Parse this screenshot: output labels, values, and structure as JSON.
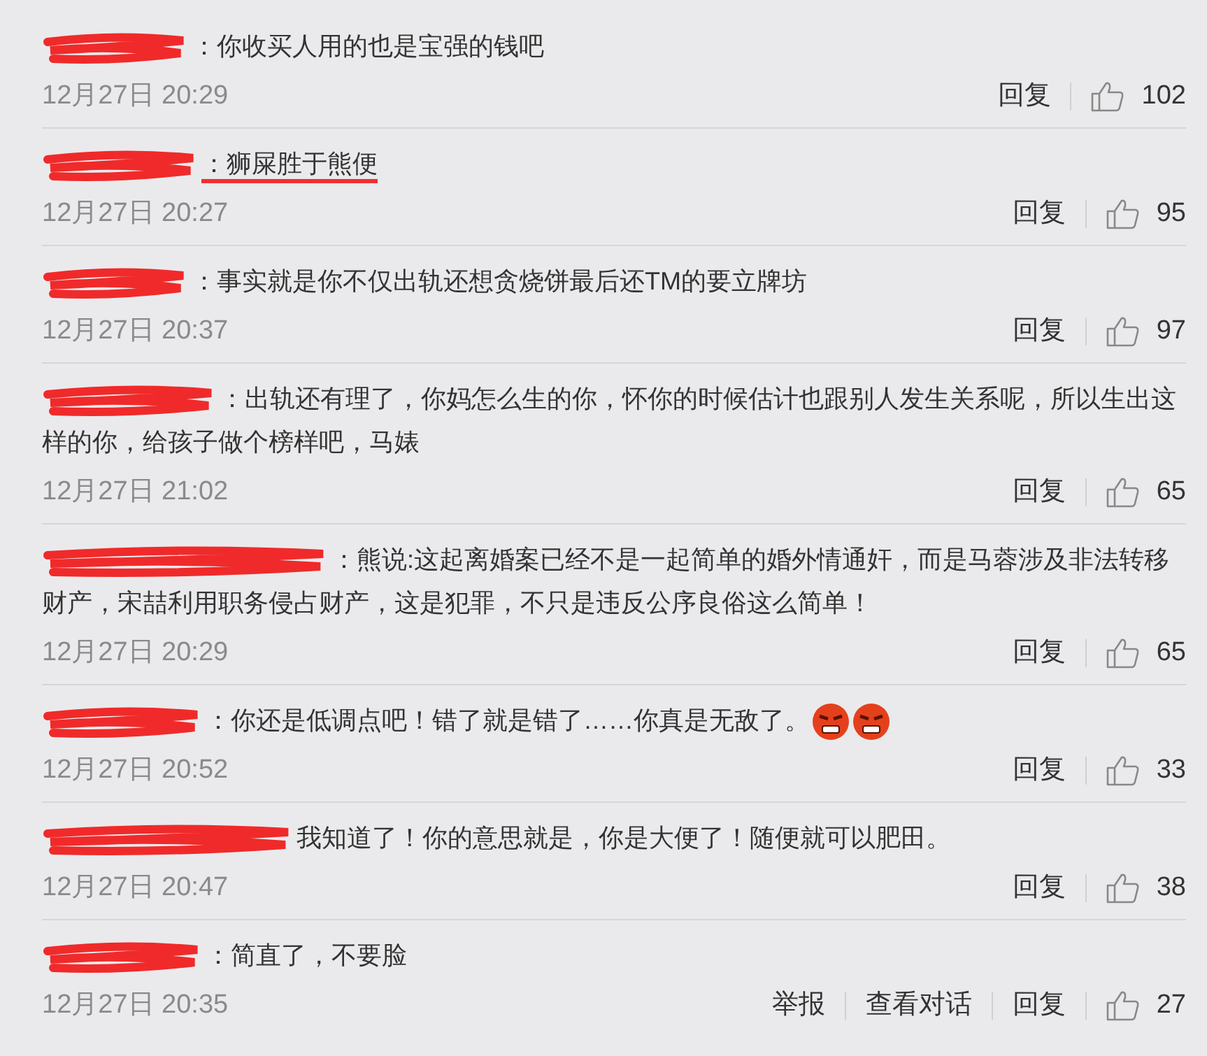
{
  "comments": [
    {
      "redacted": true,
      "text": "：你收买人用的也是宝强的钱吧",
      "time": "12月27日 20:29",
      "actions": [
        "回复"
      ],
      "likes": "102"
    },
    {
      "redacted": true,
      "text": "：狮屎胜于熊便",
      "underlined": true,
      "time": "12月27日 20:27",
      "actions": [
        "回复"
      ],
      "likes": "95"
    },
    {
      "redacted": true,
      "text": "：事实就是你不仅出轨还想贪烧饼最后还TM的要立牌坊",
      "time": "12月27日 20:37",
      "actions": [
        "回复"
      ],
      "likes": "97"
    },
    {
      "redacted": true,
      "text": "：出轨还有理了，你妈怎么生的你，怀你的时候估计也跟别人发生关系呢，所以生出这样的你，给孩子做个榜样吧，马婊",
      "time": "12月27日 21:02",
      "actions": [
        "回复"
      ],
      "likes": "65"
    },
    {
      "redacted": true,
      "text": "：熊说:这起离婚案已经不是一起简单的婚外情通奸，而是马蓉涉及非法转移财产，宋喆利用职务侵占财产，这是犯罪，不只是违反公序良俗这么简单！",
      "time": "12月27日 20:29",
      "actions": [
        "回复"
      ],
      "likes": "65"
    },
    {
      "redacted": true,
      "text": "：你还是低调点吧！错了就是错了……你真是无敌了。",
      "emoticons": [
        {
          "kind": "angry"
        },
        {
          "kind": "angry"
        }
      ],
      "time": "12月27日 20:52",
      "actions": [
        "回复"
      ],
      "likes": "33"
    },
    {
      "redacted": true,
      "text": "我知道了！你的意思就是，你是大便了！随便就可以肥田。",
      "time": "12月27日 20:47",
      "actions": [
        "回复"
      ],
      "likes": "38"
    },
    {
      "redacted": true,
      "text": "：简直了，不要脸",
      "time": "12月27日 20:35",
      "actions": [
        "举报",
        "查看对话",
        "回复"
      ],
      "likes": "27"
    }
  ]
}
